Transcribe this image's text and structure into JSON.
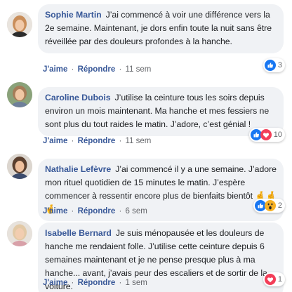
{
  "comments": [
    {
      "author": "Sophie Martin",
      "text": "J’ai commencé à voir une différence vers la 2e semaine. Maintenant, je dors enfin toute la nuit sans être réveillée par des douleurs profondes à la hanche.",
      "like_label": "J'aime",
      "reply_label": "Répondre",
      "time": "11 sem",
      "reactions": [
        "like-icon"
      ],
      "reaction_count": "3"
    },
    {
      "author": "Caroline Dubois",
      "text": "J’utilise la ceinture tous les soirs depuis environ un mois maintenant. Ma hanche et mes fessiers ne sont plus du tout raides le matin. J’adore, c’est génial !",
      "like_label": "J'aime",
      "reply_label": "Répondre",
      "time": "11 sem",
      "reactions": [
        "like-icon",
        "love-icon"
      ],
      "reaction_count": "10"
    },
    {
      "author": "Nathalie Lefèvre",
      "text": "J’ai commencé il y a une semaine. J’adore mon rituel quotidien de 15 minutes le matin. J’espère commencer à ressentir encore plus de bienfaits bientôt 🤞🤞🤞",
      "like_label": "J'aime",
      "reply_label": "Répondre",
      "time": "6 sem",
      "reactions": [
        "like-icon",
        "wow-icon"
      ],
      "reaction_count": "2"
    },
    {
      "author": "Isabelle Bernard",
      "text": "Je suis ménopausée et les douleurs de hanche me rendaient folle. J’utilise cette ceinture depuis 6 semaines maintenant et je ne pense presque plus à ma hanche... avant, j’avais peur des escaliers et de sortir de la voiture.",
      "like_label": "J'aime",
      "reply_label": "Répondre",
      "time": "1 sem",
      "reactions": [
        "love-icon"
      ],
      "reaction_count": "1"
    }
  ],
  "colors": {
    "author": "#385898",
    "bubble": "#f0f2f5",
    "like_blue": "#1877f2",
    "love_red": "#f33e58",
    "wow_yellow": "#f7b125"
  }
}
